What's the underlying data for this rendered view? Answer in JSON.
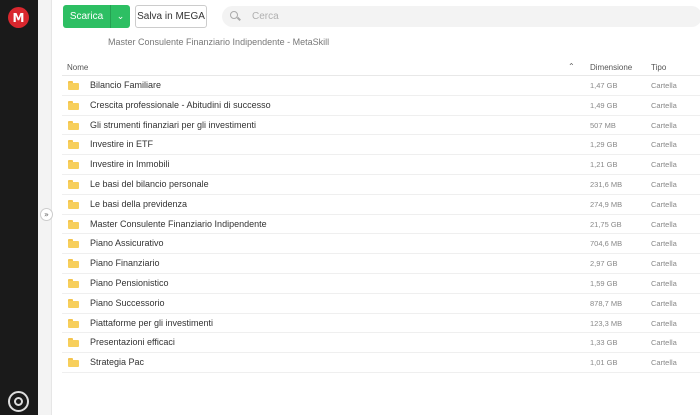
{
  "app": {
    "logo_letter": "M"
  },
  "toolbar": {
    "download_label": "Scarica",
    "caret": "⌄",
    "save_label": "Salva in MEGA",
    "search_placeholder": "Cerca"
  },
  "breadcrumb": "Master Consulente Finanziario Indipendente - MetaSkill",
  "table": {
    "headers": {
      "name": "Nome",
      "sort": "⌃",
      "size": "Dimensione",
      "type": "Tipo"
    },
    "rows": [
      {
        "name": "Bilancio Familiare",
        "size": "1,47 GB",
        "type": "Cartella"
      },
      {
        "name": "Crescita professionale - Abitudini di successo",
        "size": "1,49 GB",
        "type": "Cartella"
      },
      {
        "name": "Gli strumenti finanziari per gli investimenti",
        "size": "507 MB",
        "type": "Cartella"
      },
      {
        "name": "Investire in ETF",
        "size": "1,29 GB",
        "type": "Cartella"
      },
      {
        "name": "Investire in Immobili",
        "size": "1,21 GB",
        "type": "Cartella"
      },
      {
        "name": "Le basi del bilancio personale",
        "size": "231,6 MB",
        "type": "Cartella"
      },
      {
        "name": "Le basi della previdenza",
        "size": "274,9 MB",
        "type": "Cartella"
      },
      {
        "name": "Master Consulente Finanziario Indipendente",
        "size": "21,75 GB",
        "type": "Cartella"
      },
      {
        "name": "Piano Assicurativo",
        "size": "704,6 MB",
        "type": "Cartella"
      },
      {
        "name": "Piano Finanziario",
        "size": "2,97 GB",
        "type": "Cartella"
      },
      {
        "name": "Piano Pensionistico",
        "size": "1,59 GB",
        "type": "Cartella"
      },
      {
        "name": "Piano Successorio",
        "size": "878,7 MB",
        "type": "Cartella"
      },
      {
        "name": "Piattaforme per gli investimenti",
        "size": "123,3 MB",
        "type": "Cartella"
      },
      {
        "name": "Presentazioni efficaci",
        "size": "1,33 GB",
        "type": "Cartella"
      },
      {
        "name": "Strategia Pac",
        "size": "1,01 GB",
        "type": "Cartella"
      }
    ]
  },
  "colors": {
    "accent_green": "#2dbf63",
    "mega_red": "#d9272e",
    "folder_yellow": "#f7cf5c",
    "rail_dark": "#1a1a1a"
  },
  "icons": [
    "mega-logo-icon",
    "chevron-down-icon",
    "search-icon",
    "sort-asc-icon",
    "folder-icon",
    "expand-panel-icon",
    "transfer-manager-icon"
  ]
}
